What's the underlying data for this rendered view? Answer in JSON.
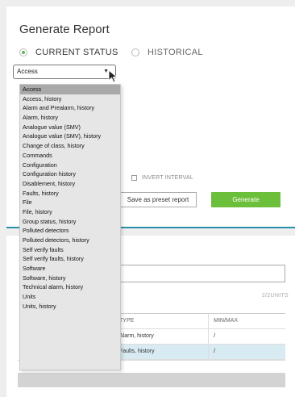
{
  "report": {
    "title": "Generate Report",
    "mode_current": "CURRENT STATUS",
    "mode_historical": "HISTORICAL",
    "selected": "Access",
    "invert_label": "INVERT INTERVAL",
    "preset_label": "Save as preset report",
    "generate_label": "Generate"
  },
  "dropdown": {
    "items": [
      "Access",
      "Access, history",
      "Alarm and Prealarm, history",
      "Alarm, history",
      "Analogue value (SMV)",
      "Analogue value (SMV), history",
      "Change of class, history",
      "Commands",
      "Configuration",
      "Configuration history",
      "Disablement, history",
      "Faults, history",
      "File",
      "File, history",
      "Group status, history",
      "Polluted detectors",
      "Polluted detectors, history",
      "Self verify faults",
      "Self verify faults, history",
      "Software",
      "Software, history",
      "Technical alarm, history",
      "Units",
      "Units, history"
    ]
  },
  "units": {
    "count": "2/2UNITS",
    "col_type": "TYPE",
    "col_minmax": "MIN/MAX",
    "rows": [
      {
        "type": "Alarm, history",
        "minmax": "/"
      },
      {
        "type": "Faults, history",
        "minmax": "/"
      }
    ]
  },
  "colors": {
    "accent": "#2a8fa8",
    "generate": "#6cbf3b",
    "radio_on": "#5cb85c",
    "row_highlight": "#d8ebf2"
  },
  "icons": {
    "dropdown_caret": "caret-down-icon",
    "cursor": "mouse-pointer-icon"
  }
}
